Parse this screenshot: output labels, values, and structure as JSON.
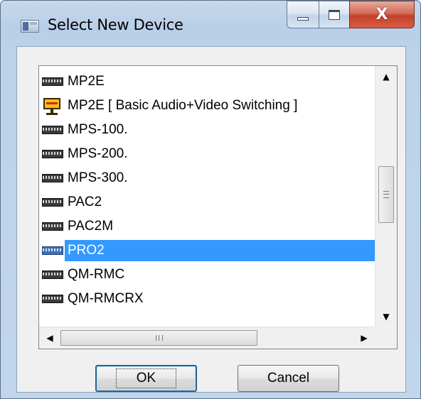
{
  "window": {
    "title": "Select New Device",
    "close_glyph": "X"
  },
  "device_list": {
    "items": [
      {
        "label": "MP2E",
        "icon": "device-icon"
      },
      {
        "label": "MP2E [ Basic Audio+Video Switching ]",
        "icon": "switch-icon"
      },
      {
        "label": "MPS-100.",
        "icon": "device-icon"
      },
      {
        "label": "MPS-200.",
        "icon": "device-icon"
      },
      {
        "label": "MPS-300.",
        "icon": "device-icon"
      },
      {
        "label": "PAC2",
        "icon": "device-icon"
      },
      {
        "label": "PAC2M",
        "icon": "device-icon"
      },
      {
        "label": "PRO2",
        "icon": "device-icon",
        "selected": true
      },
      {
        "label": "QM-RMC",
        "icon": "device-icon"
      },
      {
        "label": "QM-RMCRX",
        "icon": "device-icon"
      }
    ],
    "selected_color": "#3399ff"
  },
  "buttons": {
    "ok_label": "OK",
    "cancel_label": "Cancel"
  }
}
